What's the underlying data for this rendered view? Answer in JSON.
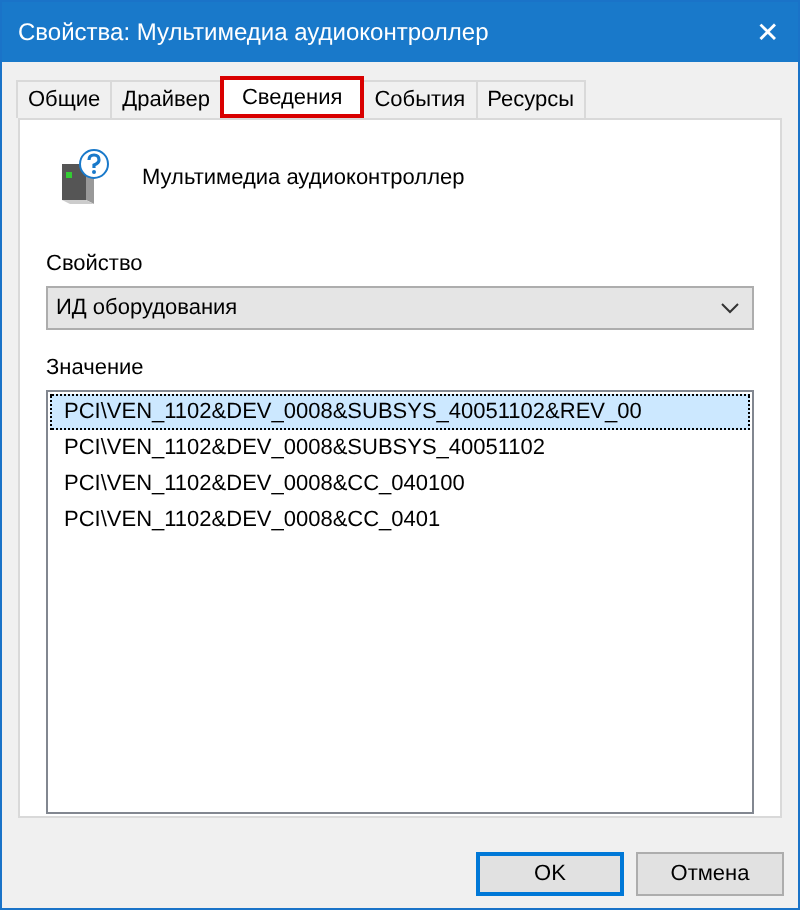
{
  "window": {
    "title": "Свойства: Мультимедиа аудиоконтроллер",
    "close": "✕"
  },
  "tabs": [
    {
      "label": "Общие",
      "selected": false
    },
    {
      "label": "Драйвер",
      "selected": false
    },
    {
      "label": "Сведения",
      "selected": true
    },
    {
      "label": "События",
      "selected": false
    },
    {
      "label": "Ресурсы",
      "selected": false
    }
  ],
  "device": {
    "name": "Мультимедиа аудиоконтроллер"
  },
  "property": {
    "label": "Свойство",
    "value": "ИД оборудования"
  },
  "values": {
    "label": "Значение",
    "items": [
      {
        "text": "PCI\\VEN_1102&DEV_0008&SUBSYS_40051102&REV_00",
        "selected": true
      },
      {
        "text": "PCI\\VEN_1102&DEV_0008&SUBSYS_40051102",
        "selected": false
      },
      {
        "text": "PCI\\VEN_1102&DEV_0008&CC_040100",
        "selected": false
      },
      {
        "text": "PCI\\VEN_1102&DEV_0008&CC_0401",
        "selected": false
      }
    ]
  },
  "buttons": [
    {
      "label": "OK",
      "default": true
    },
    {
      "label": "Отмена",
      "default": false
    }
  ]
}
